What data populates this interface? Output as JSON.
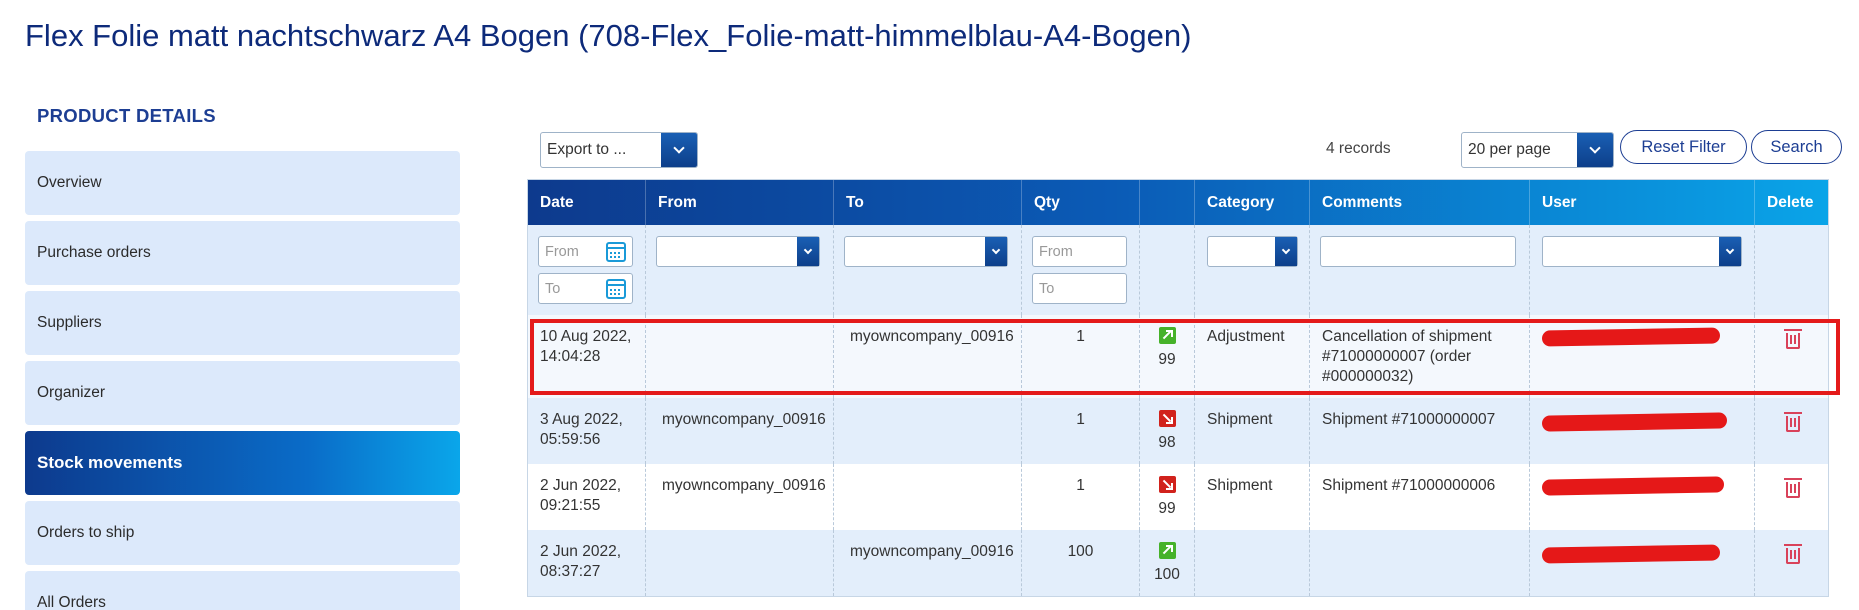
{
  "page": {
    "title": "Flex Folie matt nachtschwarz A4 Bogen (708-Flex_Folie-matt-himmelblau-A4-Bogen)"
  },
  "sidebar": {
    "section_title": "PRODUCT DETAILS",
    "items": [
      {
        "label": "Overview"
      },
      {
        "label": "Purchase orders"
      },
      {
        "label": "Suppliers"
      },
      {
        "label": "Organizer"
      },
      {
        "label": "Stock movements",
        "active": true
      },
      {
        "label": "Orders to ship"
      },
      {
        "label": "All Orders"
      }
    ]
  },
  "toolbar": {
    "export_label": "Export to ...",
    "records_label": "4 records",
    "per_page_label": "20 per page",
    "reset_label": "Reset Filter",
    "search_label": "Search"
  },
  "table": {
    "columns": [
      "Date",
      "From",
      "To",
      "Qty",
      "",
      "Category",
      "Comments",
      "User",
      "Delete"
    ],
    "filters": {
      "date_from_placeholder": "From",
      "date_to_placeholder": "To",
      "qty_from_placeholder": "From",
      "qty_to_placeholder": "To"
    },
    "rows": [
      {
        "date": "10 Aug 2022, 14:04:28",
        "from": "",
        "to": "myowncompany_00916",
        "qty": "1",
        "direction": "in",
        "stock": "99",
        "category": "Adjustment",
        "comments": "Cancellation of shipment #71000000007 (order #000000032)"
      },
      {
        "date": "3 Aug 2022, 05:59:56",
        "from": "myowncompany_00916",
        "to": "",
        "qty": "1",
        "direction": "out",
        "stock": "98",
        "category": "Shipment",
        "comments": "Shipment #71000000007"
      },
      {
        "date": "2 Jun 2022, 09:21:55",
        "from": "myowncompany_00916",
        "to": "",
        "qty": "1",
        "direction": "out",
        "stock": "99",
        "category": "Shipment",
        "comments": "Shipment #71000000006"
      },
      {
        "date": "2 Jun 2022, 08:37:27",
        "from": "",
        "to": "myowncompany_00916",
        "qty": "100",
        "direction": "in",
        "stock": "100",
        "category": "",
        "comments": ""
      }
    ]
  },
  "colors": {
    "accent": "#1d3e93",
    "title": "#0d2a7a",
    "highlight_border": "#e41a1a",
    "arrow_in": "#46b22a",
    "arrow_out": "#d1221c"
  }
}
